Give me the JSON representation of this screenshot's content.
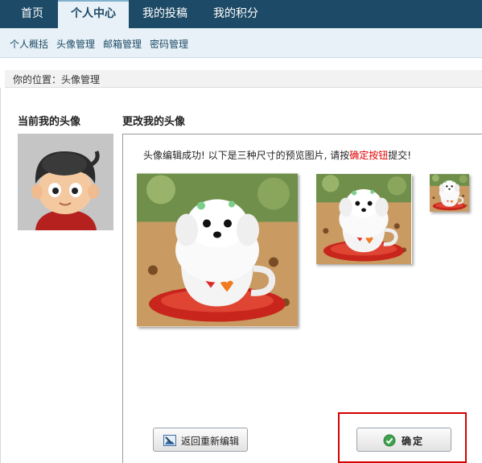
{
  "nav": {
    "tabs": [
      {
        "label": "首页",
        "active": false
      },
      {
        "label": "个人中心",
        "active": true
      },
      {
        "label": "我的投稿",
        "active": false
      },
      {
        "label": "我的积分",
        "active": false
      }
    ]
  },
  "subnav": {
    "items": [
      "个人概括",
      "头像管理",
      "邮箱管理",
      "密码管理"
    ]
  },
  "breadcrumb": "你的位置：头像管理",
  "current_avatar": {
    "heading": "当前我的头像",
    "icon": "cartoon-boy-avatar"
  },
  "change_avatar": {
    "heading": "更改我的头像",
    "message_prefix": "头像编辑成功! 以下是三种尺寸的预览图片, 请按",
    "message_link": "确定按钮",
    "message_suffix": "提交!",
    "previews": [
      "large",
      "medium",
      "small"
    ]
  },
  "buttons": {
    "back_label": "返回重新编辑",
    "confirm_label": "确定"
  },
  "colors": {
    "nav_bg": "#1d4a66",
    "subnav_bg": "#e8f1f7",
    "highlight_red": "#d40000"
  }
}
